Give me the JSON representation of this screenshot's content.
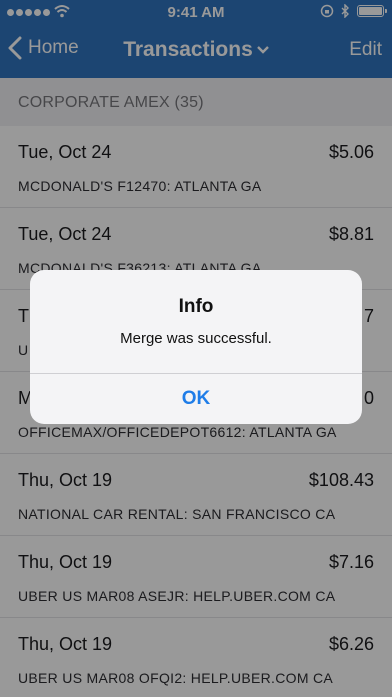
{
  "status_bar": {
    "time": "9:41 AM"
  },
  "nav": {
    "back_label": "Home",
    "title": "Transactions",
    "edit_label": "Edit"
  },
  "section": {
    "header": "CORPORATE AMEX (35)"
  },
  "transactions": [
    {
      "date": "Tue, Oct 24",
      "amount": "$5.06",
      "merchant": "MCDONALD'S F12470: ATLANTA GA"
    },
    {
      "date": "Tue, Oct 24",
      "amount": "$8.81",
      "merchant": "MCDONALD'S F36213: ATLANTA GA"
    },
    {
      "date": "T",
      "amount": "7",
      "merchant": "U"
    },
    {
      "date": "M",
      "amount": "0",
      "merchant": "OFFICEMAX/OFFICEDEPOT6612: ATLANTA GA"
    },
    {
      "date": "Thu, Oct 19",
      "amount": "$108.43",
      "merchant": "NATIONAL CAR RENTAL: SAN FRANCISCO CA"
    },
    {
      "date": "Thu, Oct 19",
      "amount": "$7.16",
      "merchant": "UBER   US MAR08 ASEJR: HELP.UBER.COM CA"
    },
    {
      "date": "Thu, Oct 19",
      "amount": "$6.26",
      "merchant": "UBER   US MAR08 OFQI2: HELP.UBER.COM CA"
    }
  ],
  "alert": {
    "title": "Info",
    "message": "Merge was successful.",
    "ok_label": "OK"
  },
  "colors": {
    "nav_blue": "#2f74bf",
    "alert_button": "#1f7de8"
  }
}
